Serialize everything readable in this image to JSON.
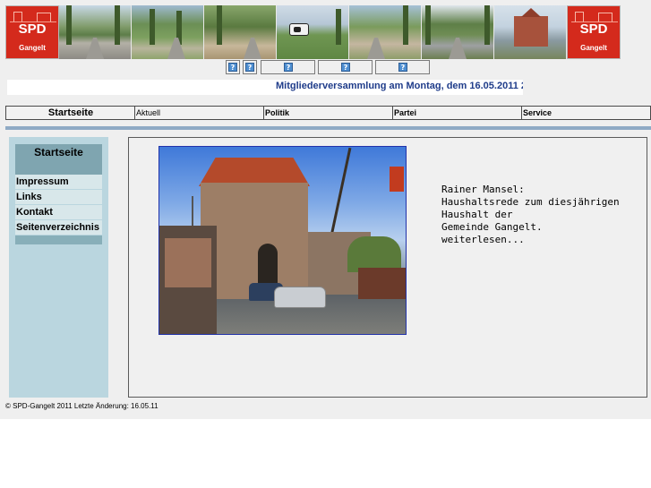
{
  "banner": {
    "logo_left": {
      "brand": "SPD",
      "town": "Gangelt"
    },
    "logo_right": {
      "brand": "SPD",
      "town": "Gangelt"
    },
    "photos": [
      "tree-lined-road-icon",
      "country-lane-icon",
      "field-path-icon",
      "cow-pasture-icon",
      "gravel-path-icon",
      "avenue-road-icon",
      "brick-house-icon"
    ]
  },
  "icon_row": {
    "icon": "broken-image-icon",
    "glyph": "?"
  },
  "marquee": {
    "text": "Mitgliederversammlung am Montag, dem 16.05.2011 2"
  },
  "nav": {
    "items": [
      {
        "label": "Startseite",
        "bold": true
      },
      {
        "label": "Aktuell",
        "bold": false
      },
      {
        "label": "Politik",
        "bold": true
      },
      {
        "label": "Partei",
        "bold": true
      },
      {
        "label": "Service",
        "bold": true
      }
    ]
  },
  "sidebar": {
    "heading": "Startseite",
    "links": [
      "Impressum",
      "Links",
      "Kontakt",
      "Seitenverzeichnis"
    ]
  },
  "main": {
    "image_icon": "town-gate-tower-photo",
    "blurb": {
      "lines": [
        "Rainer Mansel:",
        "Haushaltsrede zum diesjährigen",
        "Haushalt der",
        "Gemeinde Gangelt."
      ],
      "more_link": "weiterlesen..."
    }
  },
  "footer": {
    "text": "© SPD-Gangelt 2011 Letzte Änderung: 16.05.11"
  },
  "colors": {
    "brand_red": "#d42a1c",
    "sidebar_bg": "#bad6df",
    "marquee_text": "#1f3c8a",
    "rule": "#8faac5"
  }
}
